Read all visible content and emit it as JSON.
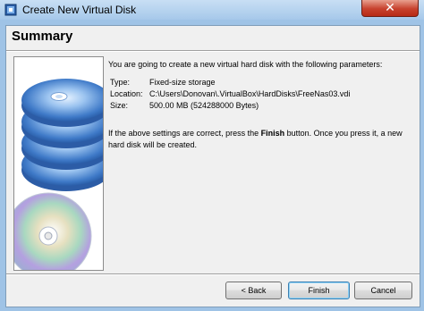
{
  "window": {
    "title": "Create New Virtual Disk",
    "close_glyph": "✕"
  },
  "header": {
    "title": "Summary"
  },
  "summary": {
    "intro": "You are going to create a new virtual hard disk with the following parameters:",
    "params": [
      {
        "label": "Type:",
        "value": "Fixed-size storage"
      },
      {
        "label": "Location:",
        "value": "C:\\Users\\Donovan\\.VirtualBox\\HardDisks\\FreeNas03.vdi"
      },
      {
        "label": "Size:",
        "value": "500.00 MB (524288000 Bytes)"
      }
    ],
    "note_before": "If the above settings are correct, press the ",
    "note_bold": "Finish",
    "note_after": " button. Once you press it, a new hard disk will be created."
  },
  "buttons": {
    "back": "< Back",
    "finish": "Finish",
    "cancel": "Cancel"
  },
  "icons": {
    "app": "virtualbox-icon",
    "illustration": "disk-stack-illustration"
  },
  "colors": {
    "title_bar": "#b9d5f0",
    "close": "#c7412d",
    "disk_blue": "#3f7ac8"
  }
}
